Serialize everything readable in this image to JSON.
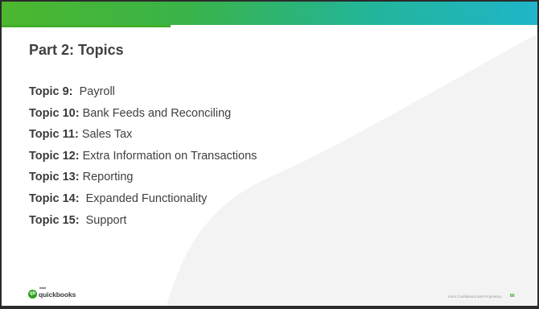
{
  "slide": {
    "title": "Part 2: Topics",
    "topics": [
      {
        "label": "Topic 9:",
        "name": "Payroll"
      },
      {
        "label": "Topic 10:",
        "name": "Bank Feeds and Reconciling"
      },
      {
        "label": "Topic 11:",
        "name": "Sales Tax"
      },
      {
        "label": "Topic 12:",
        "name": "Extra Information on Transactions"
      },
      {
        "label": "Topic 13:",
        "name": "Reporting"
      },
      {
        "label": "Topic 14:",
        "name": "Expanded Functionality"
      },
      {
        "label": "Topic 15:",
        "name": "Support"
      }
    ]
  },
  "footer": {
    "logo_intuit": "intuit",
    "logo_text": "quickbooks",
    "logo_mark": "qb",
    "confidential": "Intuit Confidential and Proprietary",
    "page_number": "80"
  },
  "colors": {
    "bar_start": "#4cb72e",
    "bar_end": "#20b5c9",
    "text": "#404040",
    "brand_green": "#2ca01c"
  },
  "icons": {
    "logo": "quickbooks-logo-icon"
  }
}
